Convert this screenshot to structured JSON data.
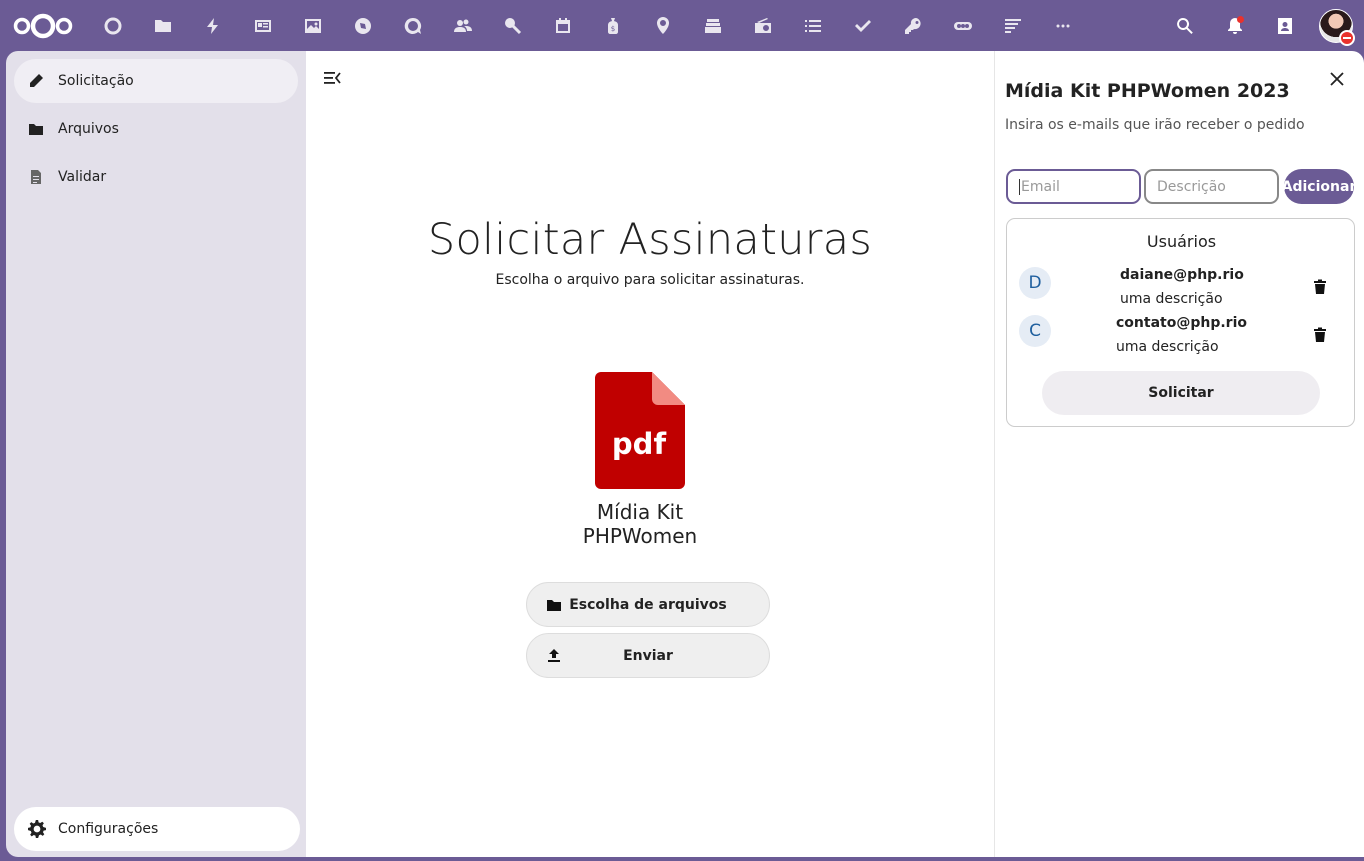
{
  "topbar": {
    "apps": [
      {
        "name": "dashboard-icon"
      },
      {
        "name": "files-icon"
      },
      {
        "name": "activity-icon"
      },
      {
        "name": "news-icon"
      },
      {
        "name": "photos-icon"
      },
      {
        "name": "maps-icon"
      },
      {
        "name": "talk-icon"
      },
      {
        "name": "contacts-icon"
      },
      {
        "name": "search-app-icon"
      },
      {
        "name": "calendar-icon"
      },
      {
        "name": "cospend-icon"
      },
      {
        "name": "location-icon"
      },
      {
        "name": "deck-icon"
      },
      {
        "name": "radio-icon"
      },
      {
        "name": "list-icon"
      },
      {
        "name": "tasks-icon"
      },
      {
        "name": "passwords-icon"
      },
      {
        "name": "libresign-icon"
      },
      {
        "name": "notes-icon"
      },
      {
        "name": "more-apps-icon"
      }
    ]
  },
  "sidebar": {
    "items": [
      {
        "label": "Solicitação",
        "icon": "pencil-icon"
      },
      {
        "label": "Arquivos",
        "icon": "folder-icon"
      },
      {
        "label": "Validar",
        "icon": "document-icon"
      }
    ],
    "settings_label": "Configurações"
  },
  "main": {
    "title": "Solicitar Assinaturas",
    "subtitle": "Escolha o arquivo para solicitar assinaturas.",
    "file_badge": "pdf",
    "file_name_line1": "Mídia Kit",
    "file_name_line2": "PHPWomen",
    "choose_files_label": "Escolha de arquivos",
    "send_label": "Enviar"
  },
  "panel": {
    "title": "Mídia Kit PHPWomen 2023",
    "subtitle": "Insira os e-mails que irão receber o pedido",
    "email_placeholder": "Email",
    "description_placeholder": "Descrição",
    "add_label": "Adicionar",
    "users_title": "Usuários",
    "users": [
      {
        "initial": "D",
        "email": "daiane@php.rio",
        "description": "uma descrição"
      },
      {
        "initial": "C",
        "email": "contato@php.rio",
        "description": "uma descrição"
      }
    ],
    "request_label": "Solicitar"
  },
  "colors": {
    "brand": "#6b5b95",
    "pdf_red": "#c00000",
    "notification": "#e9322d"
  }
}
